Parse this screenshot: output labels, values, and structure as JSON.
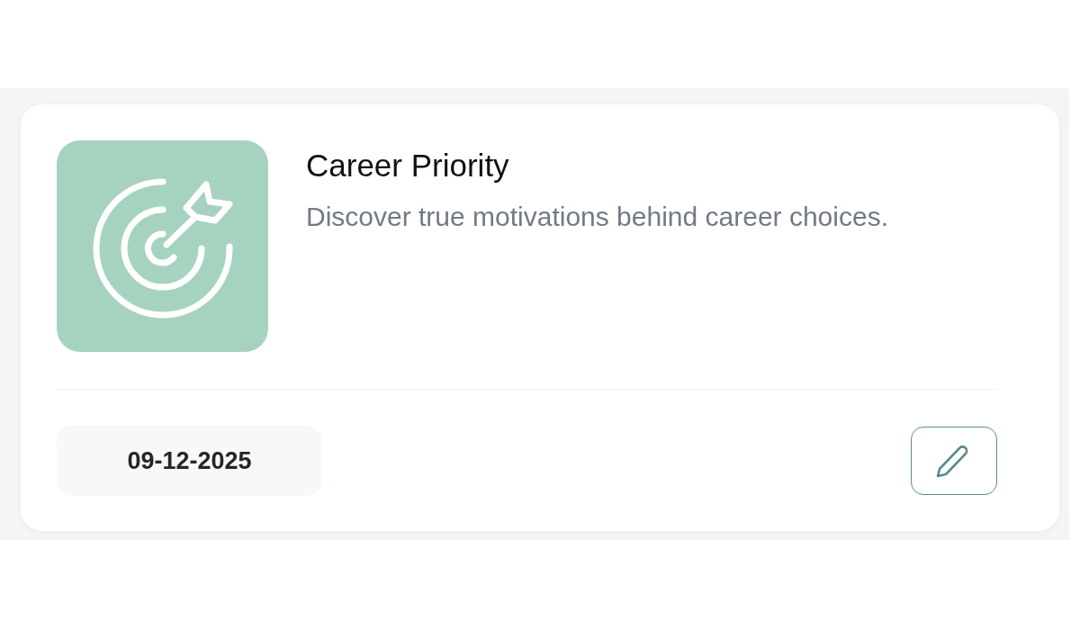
{
  "card": {
    "title": "Career Priority",
    "description": "Discover true motivations behind career choices.",
    "date": "09-12-2025"
  }
}
